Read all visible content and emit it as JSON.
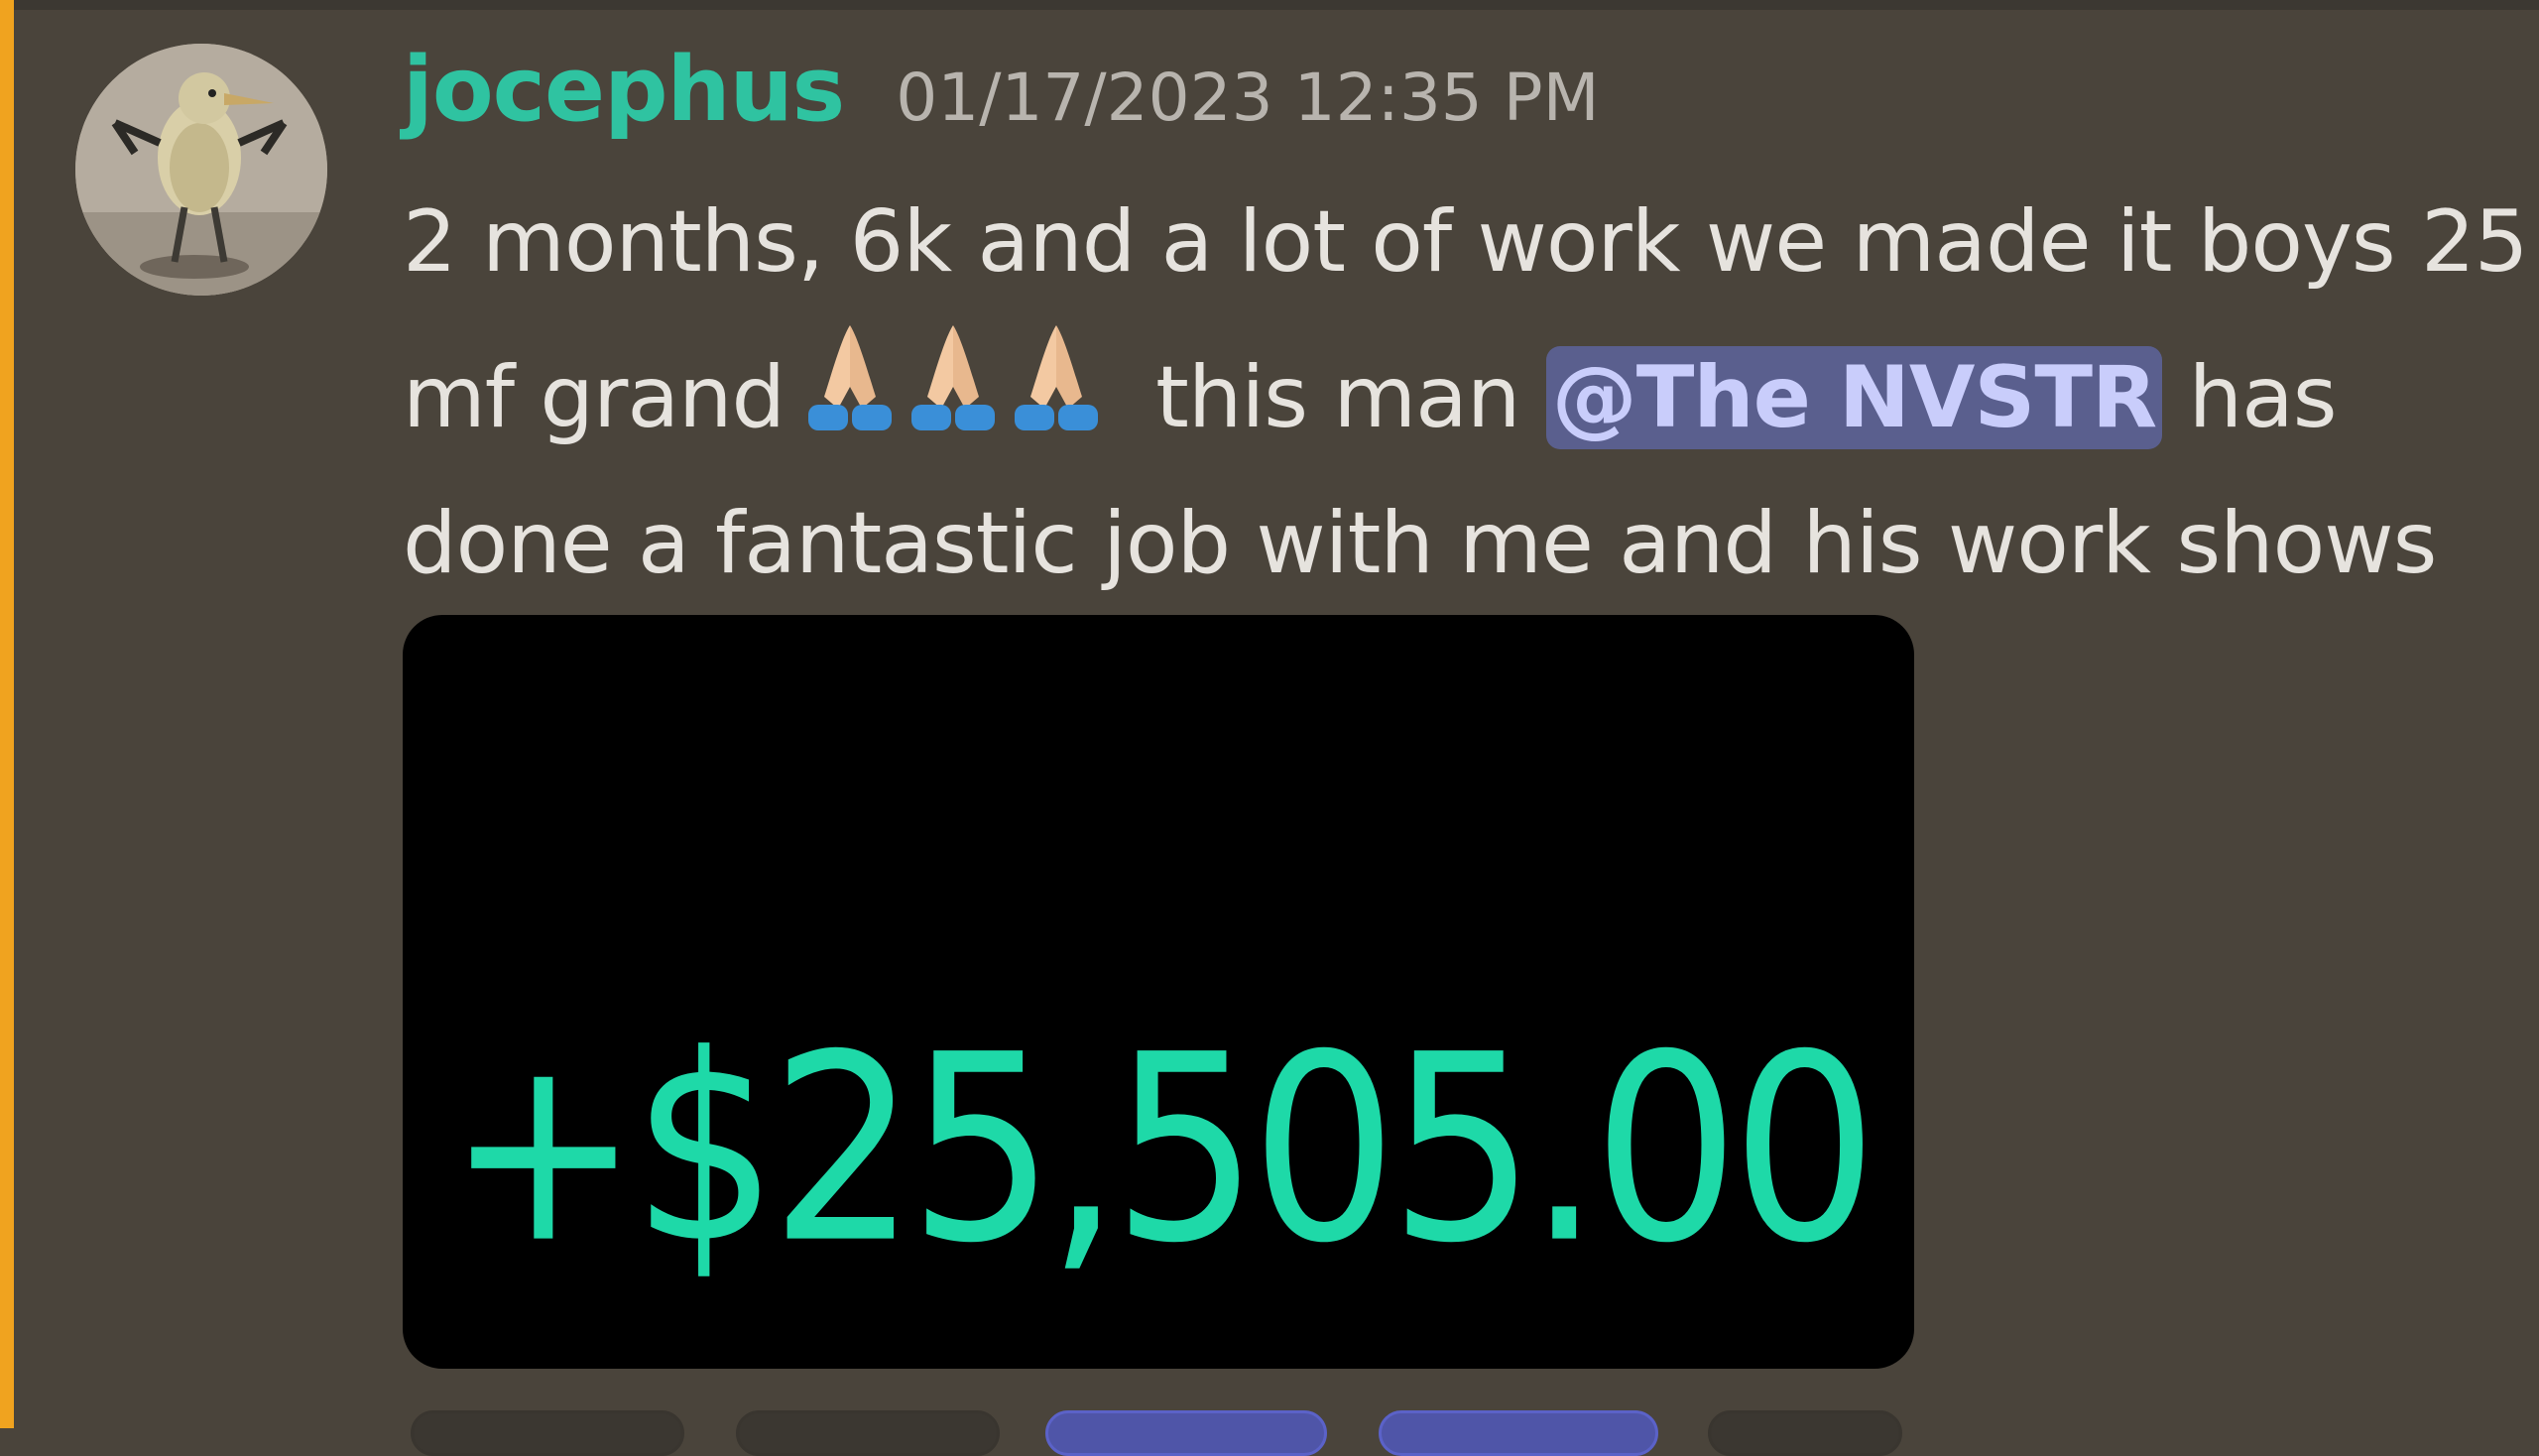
{
  "message": {
    "username": "jocephus",
    "timestamp": "01/17/2023 12:35 PM",
    "avatar_icon": "bird-avatar",
    "content": {
      "line1": "2 months, 6k and a lot of work we made it boys 25",
      "line2_before": "mf grand",
      "emojis": [
        "folded-hands-icon",
        "folded-hands-icon",
        "folded-hands-icon"
      ],
      "line2_middle": "this man",
      "mention": "@The NVSTR",
      "line2_after": "has",
      "line3": "done a fantastic job with me and his work shows"
    },
    "attachment": {
      "amount": "+$25,505.00"
    },
    "reactions": [
      {
        "active": false
      },
      {
        "active": false
      },
      {
        "active": true
      },
      {
        "active": true
      },
      {
        "active": false
      }
    ]
  },
  "colors": {
    "background": "#4a443b",
    "username": "#2fc3a1",
    "highlight_bar": "#f0a31f",
    "mention_bg": "#5a5f8e",
    "mention_text": "#c9cdfb",
    "amount": "#1ed9a8"
  }
}
